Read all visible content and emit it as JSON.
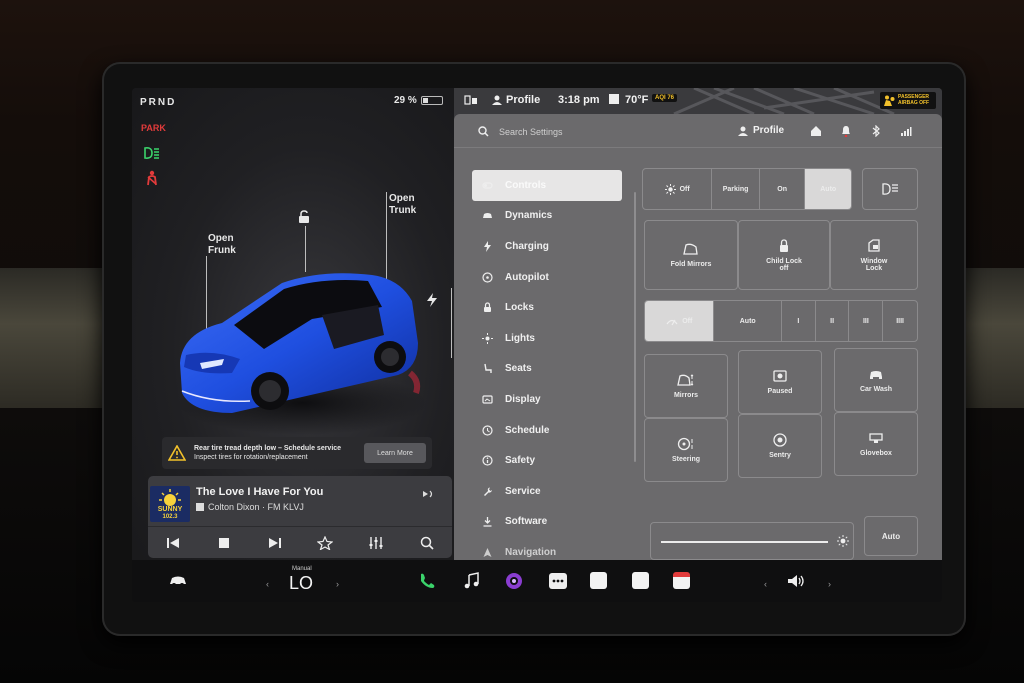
{
  "left_panel": {
    "gear": "PRND",
    "battery_percent": "29 %",
    "battery_level": 0.29,
    "park_label": "PARK",
    "callouts": {
      "frunk_line1": "Open",
      "frunk_line2": "Frunk",
      "trunk_line1": "Open",
      "trunk_line2": "Trunk"
    },
    "alert": {
      "title": "Rear tire tread depth low – Schedule service",
      "detail": "Inspect tires for rotation/replacement",
      "button": "Learn More"
    },
    "media": {
      "station_logo_top": "SUNNY",
      "station_logo_bottom": "102.3",
      "song_title": "The Love I Have For You",
      "artist_source": "Colton Dixon · FM KLVJ"
    }
  },
  "status_bar": {
    "profile": "Profile",
    "time": "3:18 pm",
    "temperature": "70°F",
    "aqi": "AQI 76",
    "airbag_line1": "PASSENGER",
    "airbag_line2": "AIRBAG OFF"
  },
  "settings": {
    "search_placeholder": "Search Settings",
    "profile_label": "Profile",
    "menu": [
      {
        "label": "Controls",
        "icon": "toggle-icon"
      },
      {
        "label": "Dynamics",
        "icon": "car-icon"
      },
      {
        "label": "Charging",
        "icon": "bolt-icon"
      },
      {
        "label": "Autopilot",
        "icon": "steering-icon"
      },
      {
        "label": "Locks",
        "icon": "lock-icon"
      },
      {
        "label": "Lights",
        "icon": "sun-icon"
      },
      {
        "label": "Seats",
        "icon": "seat-icon"
      },
      {
        "label": "Display",
        "icon": "display-icon"
      },
      {
        "label": "Schedule",
        "icon": "clock-icon"
      },
      {
        "label": "Safety",
        "icon": "info-icon"
      },
      {
        "label": "Service",
        "icon": "wrench-icon"
      },
      {
        "label": "Software",
        "icon": "download-icon"
      },
      {
        "label": "Navigation",
        "icon": "navigation-icon"
      }
    ],
    "lights_row": {
      "off": "Off",
      "parking": "Parking",
      "on": "On",
      "auto": "Auto",
      "selected": "Auto"
    },
    "mirror_row": {
      "fold_mirrors": "Fold Mirrors",
      "child_lock_line1": "Child Lock",
      "child_lock_line2": "off",
      "window_lock_line1": "Window",
      "window_lock_line2": "Lock"
    },
    "wiper_row": {
      "off": "Off",
      "auto": "Auto",
      "speeds": [
        "I",
        "II",
        "III",
        "IIII"
      ],
      "selected": "Off"
    },
    "tiles": {
      "mirrors": "Mirrors",
      "paused": "Paused",
      "car_wash": "Car Wash",
      "steering": "Steering",
      "sentry": "Sentry",
      "glovebox": "Glovebox"
    },
    "brightness_level": 0.92,
    "brightness_auto": "Auto"
  },
  "taskbar": {
    "climate_mode": "Manual",
    "temperature": "LO"
  }
}
